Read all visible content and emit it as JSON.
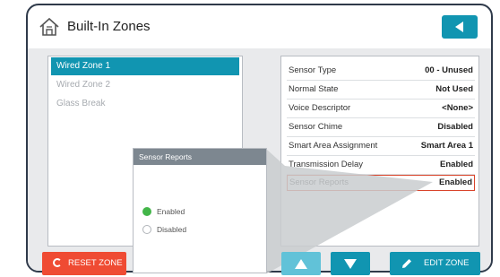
{
  "header": {
    "title": "Built-In Zones",
    "home_icon": "home-icon",
    "back_icon": "arrow-left-icon"
  },
  "zones": [
    {
      "label": "Wired Zone 1",
      "selected": true
    },
    {
      "label": "Wired Zone 2",
      "selected": false
    },
    {
      "label": "Glass Break",
      "selected": false
    }
  ],
  "properties": [
    {
      "key": "Sensor Type",
      "value": "00 - Unused"
    },
    {
      "key": "Normal State",
      "value": "Not Used"
    },
    {
      "key": "Voice Descriptor",
      "value": "<None>"
    },
    {
      "key": "Sensor Chime",
      "value": "Disabled"
    },
    {
      "key": "Smart Area Assignment",
      "value": "Smart Area 1"
    },
    {
      "key": "Transmission Delay",
      "value": "Enabled"
    },
    {
      "key": "Sensor Reports",
      "value": "Enabled",
      "highlighted": true
    }
  ],
  "popup": {
    "title": "Sensor Reports",
    "options": [
      {
        "label": "Enabled",
        "selected": true
      },
      {
        "label": "Disabled",
        "selected": false
      }
    ]
  },
  "buttons": {
    "reset": "RESET ZONE",
    "edit": "EDIT ZONE"
  },
  "colors": {
    "accent": "#1195b1",
    "accent_light": "#61c2d8",
    "danger": "#ef4b33",
    "highlight": "#d9442b",
    "selected_radio": "#43b649"
  }
}
